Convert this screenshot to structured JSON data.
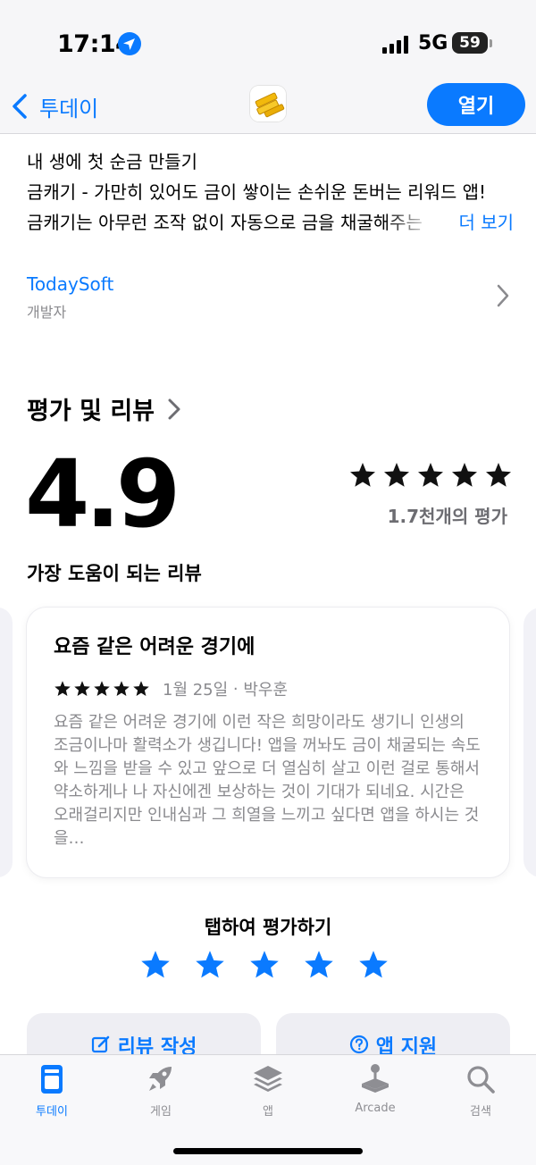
{
  "status_bar": {
    "time": "17:14",
    "network": "5G",
    "battery": "59"
  },
  "nav": {
    "back_label": "투데이",
    "open_label": "열기"
  },
  "description": {
    "line1": "내 생에 첫 순금 만들기",
    "line2": "금캐기 - 가만히 있어도 금이 쌓이는 손쉬운 돈버는 리워드 앱!",
    "line3": "금캐기는 아무런 조작 없이 자동으로 금을 채굴해주는",
    "more": "더 보기"
  },
  "developer": {
    "name": "TodaySoft",
    "label": "개발자"
  },
  "ratings": {
    "title": "평가 및 리뷰",
    "score": "4.9",
    "count": "1.7천개의 평가",
    "stars": 5
  },
  "helpful_title": "가장 도움이 되는 리뷰",
  "review": {
    "title": "요즘 같은 어려운 경기에",
    "date": "1월 25일",
    "author": "박우훈",
    "stars": 5,
    "body": "요즘 같은 어려운 경기에 이런 작은 희망이라도 생기니 인생의 조금이나마 활력소가 생깁니다! 앱을 꺼놔도 금이 채굴되는 속도와 느낌을 받을 수 있고 앞으로 더 열심히 살고 이런 걸로 통해서 약소하게나 나 자신에겐 보상하는 것이 기대가 되네요. 시간은 오래걸리지만 인내심과 그 희열을 느끼고 싶다면  앱을 하시는 것을…"
  },
  "tap_to_rate": {
    "title": "탭하여 평가하기"
  },
  "actions": {
    "write_review": "리뷰 작성",
    "app_support": "앱 지원"
  },
  "tabs": [
    {
      "label": "투데이",
      "icon": "today-icon"
    },
    {
      "label": "게임",
      "icon": "rocket-icon"
    },
    {
      "label": "앱",
      "icon": "layers-icon"
    },
    {
      "label": "Arcade",
      "icon": "joystick-icon"
    },
    {
      "label": "검색",
      "icon": "search-icon"
    }
  ],
  "colors": {
    "accent": "#0a7aff",
    "secondary_text": "#8a8a8e"
  }
}
